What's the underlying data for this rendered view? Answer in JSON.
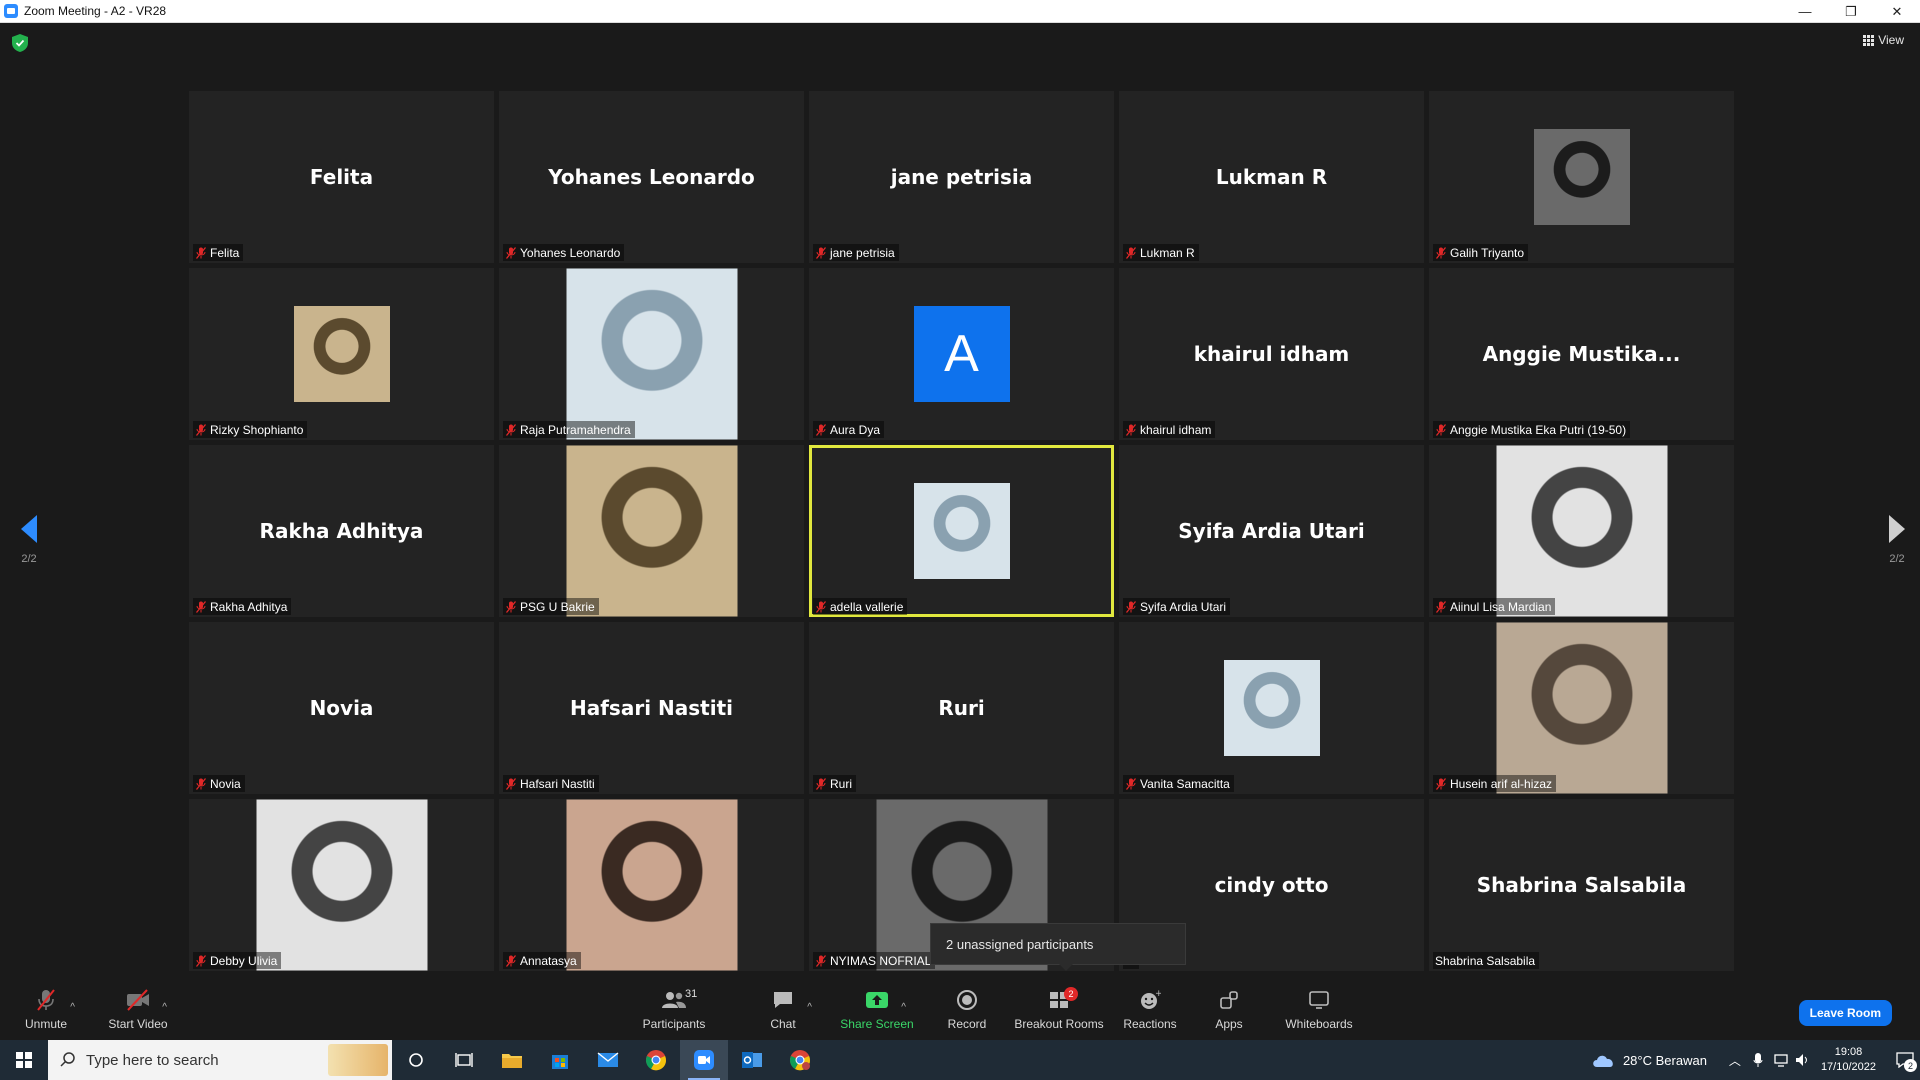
{
  "window": {
    "title": "Zoom Meeting - A2 - VR28",
    "minimize": "—",
    "restore": "❐",
    "close": "✕"
  },
  "meeting": {
    "view_label": "View",
    "page_left": "2/2",
    "page_right": "2/2",
    "tooltip": "2 unassigned participants"
  },
  "participants": [
    {
      "display": "Felita",
      "label": "Felita",
      "muted": true,
      "kind": "name"
    },
    {
      "display": "Yohanes Leonardo",
      "label": "Yohanes Leonardo",
      "muted": true,
      "kind": "name"
    },
    {
      "display": "jane petrisia",
      "label": "jane petrisia",
      "muted": true,
      "kind": "name"
    },
    {
      "display": "Lukman R",
      "label": "Lukman R",
      "muted": true,
      "kind": "name"
    },
    {
      "display": "",
      "label": "Galih Triyanto",
      "muted": true,
      "kind": "photo-sq"
    },
    {
      "display": "",
      "label": "Rizky Shophianto",
      "muted": true,
      "kind": "photo-sq"
    },
    {
      "display": "",
      "label": "Raja Putramahendra",
      "muted": true,
      "kind": "photo-tall"
    },
    {
      "display": "A",
      "label": "Aura Dya",
      "muted": true,
      "kind": "letter"
    },
    {
      "display": "khairul idham",
      "label": "khairul idham",
      "muted": true,
      "kind": "name"
    },
    {
      "display": "Anggie  Mustika...",
      "label": "Anggie Mustika Eka Putri (19-50)",
      "muted": true,
      "kind": "name"
    },
    {
      "display": "Rakha Adhitya",
      "label": "Rakha Adhitya",
      "muted": true,
      "kind": "name"
    },
    {
      "display": "",
      "label": "PSG U Bakrie",
      "muted": true,
      "kind": "photo-tall"
    },
    {
      "display": "",
      "label": "adella vallerie",
      "muted": true,
      "kind": "photo-sq",
      "active": true
    },
    {
      "display": "Syifa Ardia Utari",
      "label": "Syifa Ardia Utari",
      "muted": true,
      "kind": "name"
    },
    {
      "display": "",
      "label": "Aiinul Lisa Mardian",
      "muted": true,
      "kind": "photo-tall"
    },
    {
      "display": "Novia",
      "label": "Novia",
      "muted": true,
      "kind": "name"
    },
    {
      "display": "Hafsari Nastiti",
      "label": "Hafsari Nastiti",
      "muted": true,
      "kind": "name"
    },
    {
      "display": "Ruri",
      "label": "Ruri",
      "muted": true,
      "kind": "name"
    },
    {
      "display": "",
      "label": "Vanita Samacitta",
      "muted": true,
      "kind": "photo-sq"
    },
    {
      "display": "",
      "label": "Husein arif al-hizaz",
      "muted": true,
      "kind": "photo-tall"
    },
    {
      "display": "",
      "label": "Debby Ulivia",
      "muted": true,
      "kind": "photo-tall"
    },
    {
      "display": "",
      "label": "Annatasya",
      "muted": true,
      "kind": "photo-tall"
    },
    {
      "display": "",
      "label": "NYIMAS NOFRIAL",
      "muted": true,
      "kind": "photo-tall"
    },
    {
      "display": "cindy otto",
      "label": "to",
      "muted": false,
      "kind": "name"
    },
    {
      "display": "Shabrina Salsabila",
      "label": "Shabrina Salsabila",
      "muted": false,
      "kind": "name"
    }
  ],
  "toolbar": {
    "unmute": "Unmute",
    "start_video": "Start Video",
    "participants": "Participants",
    "participants_count": "31",
    "chat": "Chat",
    "share_screen": "Share Screen",
    "record": "Record",
    "breakout_rooms": "Breakout Rooms",
    "breakout_badge": "2",
    "reactions": "Reactions",
    "apps": "Apps",
    "whiteboards": "Whiteboards",
    "leave": "Leave Room"
  },
  "taskbar": {
    "search_placeholder": "Type here to search",
    "weather": "28°C  Berawan",
    "time": "19:08",
    "date": "17/10/2022",
    "notifications": "2"
  },
  "colors": {
    "zoom_blue": "#0e72ed",
    "active_speaker": "#e1e83e",
    "share_green": "#3ad668",
    "mute_red": "#e02828"
  }
}
